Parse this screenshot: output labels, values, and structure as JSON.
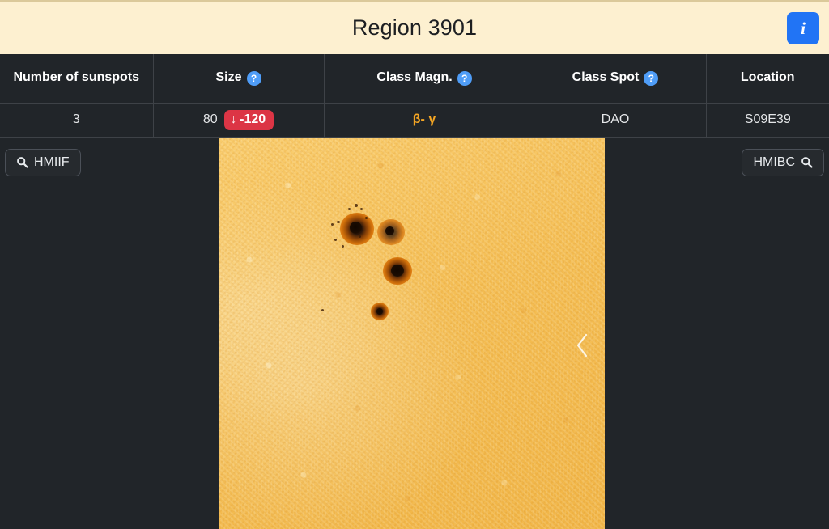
{
  "header": {
    "title": "Region 3901",
    "info_button": {
      "label": "i",
      "icon": "info-icon",
      "color": "#2174f5"
    }
  },
  "table": {
    "columns": [
      {
        "key": "sunspots",
        "label": "Number of sunspots",
        "has_help": false
      },
      {
        "key": "size",
        "label": "Size",
        "has_help": true,
        "help_label": "?"
      },
      {
        "key": "class_magn",
        "label": "Class Magn.",
        "has_help": true,
        "help_label": "?"
      },
      {
        "key": "class_spot",
        "label": "Class Spot",
        "has_help": true,
        "help_label": "?"
      },
      {
        "key": "location",
        "label": "Location",
        "has_help": false
      }
    ],
    "row": {
      "sunspots": "3",
      "size_value": "80",
      "size_delta": "-120",
      "size_delta_arrow": "↓",
      "size_delta_color": "#dc3545",
      "class_magn": "β- γ",
      "class_magn_color": "#f5a623",
      "class_spot": "DAO",
      "location": "S09E39"
    }
  },
  "viewer": {
    "left_button": {
      "label": "HMIIF",
      "icon": "search-icon"
    },
    "right_button": {
      "label": "HMIBC",
      "icon": "search-icon"
    },
    "prev_control": {
      "icon": "chevron-left-icon"
    },
    "image_alt": "HMI intensitygram of solar active region showing three sunspots"
  },
  "colors": {
    "page_background": "#212529",
    "header_background": "#fdf0d0",
    "accent_blue": "#2174f5",
    "help_blue": "#4f9df7",
    "badge_red": "#dc3545",
    "class_magn_orange": "#f5a623",
    "sun_surface": "#f7c55f"
  }
}
